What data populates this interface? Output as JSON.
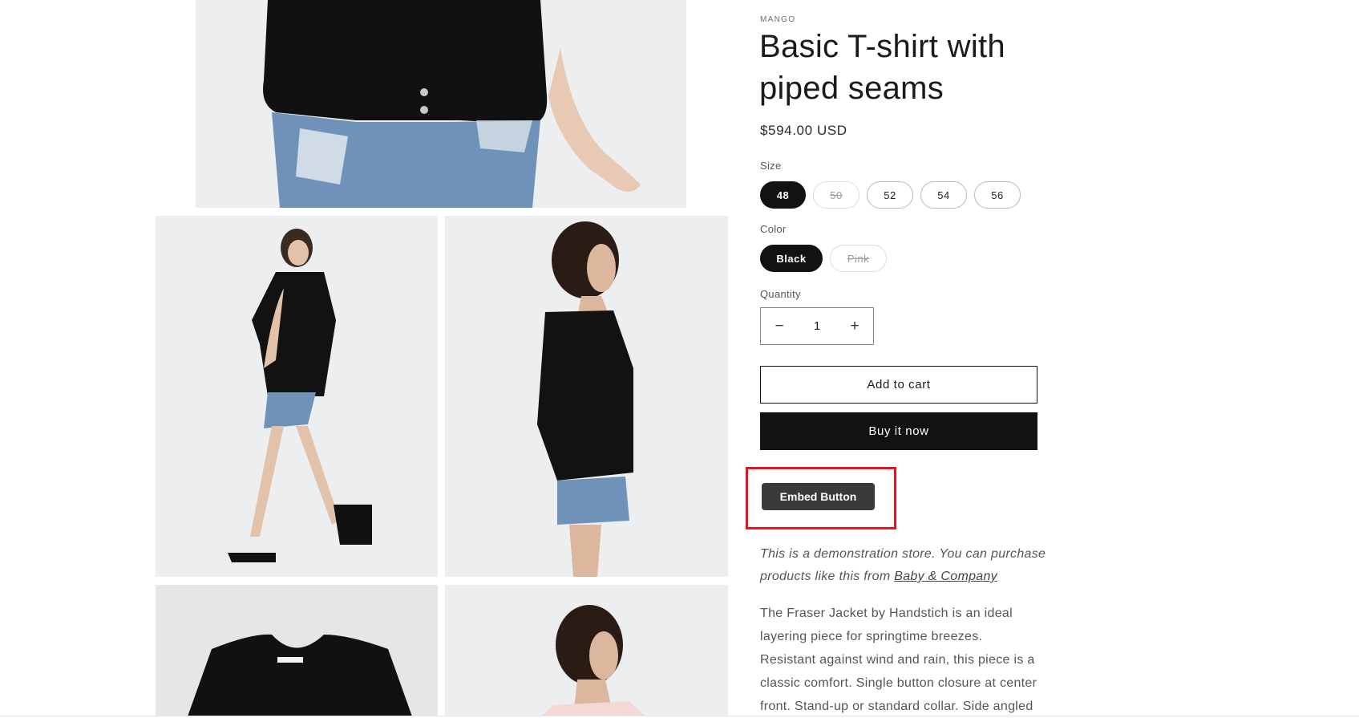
{
  "product": {
    "vendor": "MANGO",
    "title": "Basic T-shirt with piped seams",
    "price": "$594.00 USD"
  },
  "size": {
    "label": "Size",
    "options": [
      "48",
      "50",
      "52",
      "54",
      "56"
    ],
    "selected": "48",
    "unavailable": [
      "50"
    ]
  },
  "color": {
    "label": "Color",
    "options": [
      "Black",
      "Pink"
    ],
    "selected": "Black",
    "unavailable": [
      "Pink"
    ]
  },
  "quantity": {
    "label": "Quantity",
    "value": "1",
    "minus": "−",
    "plus": "+"
  },
  "actions": {
    "add_to_cart": "Add to cart",
    "buy_now": "Buy it now",
    "embed": "Embed Button"
  },
  "demo_note": {
    "text": "This is a demonstration store. You can purchase products like this from ",
    "link": "Baby & Company"
  },
  "description": "The Fraser Jacket by Handstich is an ideal layering piece for springtime breezes. Resistant against wind and rain, this piece is a classic comfort. Single button closure at center front. Stand-up or standard collar. Side angled",
  "colors": {
    "primary": "#121212",
    "highlight": "#e1161f",
    "embed": "#3a3a3a"
  }
}
